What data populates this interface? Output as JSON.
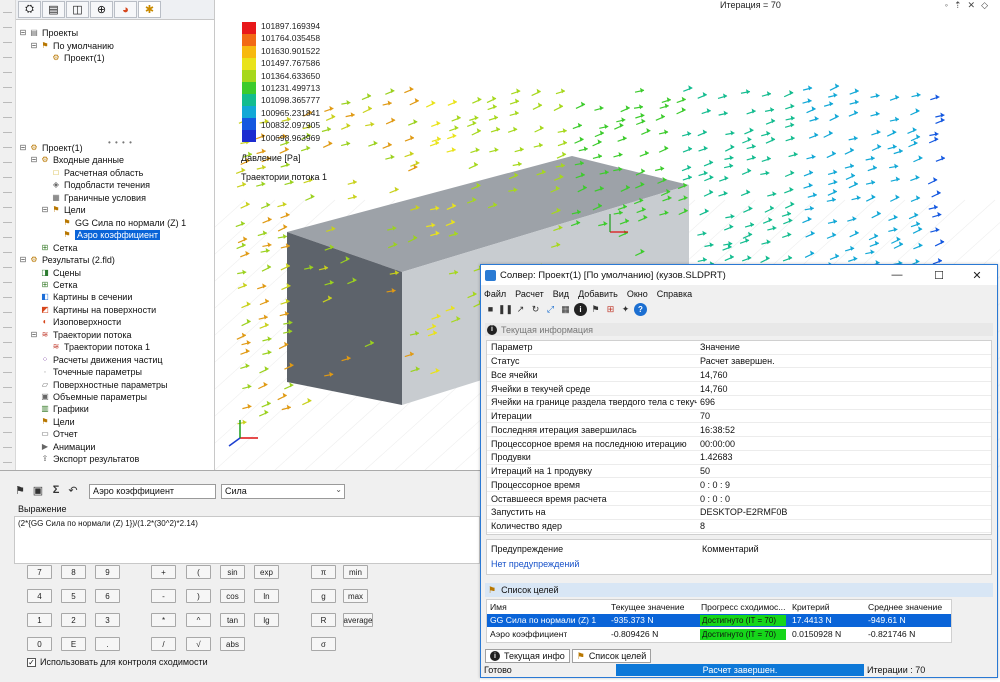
{
  "feature_tree": {
    "top": [
      {
        "label": "Проекты",
        "icon": "projects-icon",
        "level": 0
      },
      {
        "label": "По умолчанию",
        "icon": "config-icon",
        "level": 1
      },
      {
        "label": "Проект(1)",
        "icon": "project-icon",
        "level": 2
      }
    ],
    "bottom": [
      {
        "label": "Проект(1)",
        "icon": "project-icon",
        "level": 0
      },
      {
        "label": "Входные данные",
        "icon": "input-data-icon",
        "level": 1
      },
      {
        "label": "Расчетная область",
        "icon": "domain-icon",
        "level": 2
      },
      {
        "label": "Подобласти течения",
        "icon": "subdomain-icon",
        "level": 2
      },
      {
        "label": "Граничные условия",
        "icon": "boundary-icon",
        "level": 2
      },
      {
        "label": "Цели",
        "icon": "goals-icon",
        "level": 2
      },
      {
        "label": "GG Сила по нормали (Z) 1",
        "icon": "goal-icon",
        "level": 3
      },
      {
        "label": "Аэро коэффициент",
        "icon": "goal-icon",
        "level": 3,
        "selected": true
      },
      {
        "label": "Сетка",
        "icon": "mesh-icon",
        "level": 1
      },
      {
        "label": "Результаты (2.fld)",
        "icon": "results-icon",
        "level": 0
      },
      {
        "label": "Сцены",
        "icon": "scenes-icon",
        "level": 1
      },
      {
        "label": "Сетка",
        "icon": "mesh-icon",
        "level": 1
      },
      {
        "label": "Картины в сечении",
        "icon": "cut-plot-icon",
        "level": 1
      },
      {
        "label": "Картины на поверхности",
        "icon": "surface-plot-icon",
        "level": 1
      },
      {
        "label": "Изоповерхности",
        "icon": "isosurface-icon",
        "level": 1
      },
      {
        "label": "Траектории потока",
        "icon": "flow-traj-icon",
        "level": 1
      },
      {
        "label": "Траектории потока 1",
        "icon": "flow-traj-icon",
        "level": 2
      },
      {
        "label": "Расчеты движения частиц",
        "icon": "particle-icon",
        "level": 1
      },
      {
        "label": "Точечные параметры",
        "icon": "point-params-icon",
        "level": 1
      },
      {
        "label": "Поверхностные параметры",
        "icon": "surface-params-icon",
        "level": 1
      },
      {
        "label": "Объемные параметры",
        "icon": "volume-params-icon",
        "level": 1
      },
      {
        "label": "Графики",
        "icon": "graphs-icon",
        "level": 1
      },
      {
        "label": "Цели",
        "icon": "goals-icon",
        "level": 1
      },
      {
        "label": "Отчет",
        "icon": "report-icon",
        "level": 1
      },
      {
        "label": "Анимации",
        "icon": "animation-icon",
        "level": 1
      },
      {
        "label": "Экспорт результатов",
        "icon": "export-icon",
        "level": 1
      }
    ]
  },
  "viewport": {
    "iteration_label": "Итерация = 70",
    "legend_values": [
      "101897.169394",
      "101764.035458",
      "101630.901522",
      "101497.767586",
      "101364.633650",
      "101231.499713",
      "101098.365777",
      "100965.231841",
      "100832.097905",
      "100698.963969"
    ],
    "legend_title": "Давление [Pa]",
    "trajectory_title": "Траектории потока 1",
    "legend_colors": [
      "#e8181a",
      "#f26a14",
      "#f7b90f",
      "#e9e31a",
      "#a6d81c",
      "#3ccb2c",
      "#13bc8f",
      "#12a8d6",
      "#1458e0",
      "#1c2bd0"
    ]
  },
  "expression_editor": {
    "name_value": "Аэро коэффициент",
    "type_value": "Сила",
    "label": "Выражение",
    "expression": "(2*{GG Сила по нормали (Z) 1})/(1.2*(30^2)*2.14)",
    "keys": [
      [
        "7",
        "8",
        "9"
      ],
      [
        "4",
        "5",
        "6"
      ],
      [
        "1",
        "2",
        "3"
      ],
      [
        "0",
        "E",
        "."
      ]
    ],
    "ops": [
      [
        "+",
        "("
      ],
      [
        "-",
        ")"
      ],
      [
        "*",
        "^"
      ],
      [
        "/",
        "√"
      ]
    ],
    "funcs": [
      [
        "sin",
        "exp"
      ],
      [
        "cos",
        "ln"
      ],
      [
        "tan",
        "lg"
      ],
      [
        "abs",
        ""
      ]
    ],
    "consts": [
      [
        "π",
        "min"
      ],
      [
        "g",
        "max"
      ],
      [
        "R",
        "average"
      ],
      [
        "σ",
        ""
      ]
    ],
    "use_for_convergence_label": "Использовать для контроля сходимости",
    "use_for_convergence": true
  },
  "solver": {
    "title": "Солвер: Проект(1) [По умолчанию] (кузов.SLDPRT)",
    "menu": [
      "Файл",
      "Расчет",
      "Вид",
      "Добавить",
      "Окно",
      "Справка"
    ],
    "current_info_header": "Текущая информация",
    "params_header": {
      "name": "Параметр",
      "value": "Значение"
    },
    "params": [
      {
        "name": "Статус",
        "value": "Расчет завершен."
      },
      {
        "name": "Все ячейки",
        "value": "14,760"
      },
      {
        "name": "Ячейки в текучей среде",
        "value": "14,760"
      },
      {
        "name": "Ячейки на границе раздела твердого тела с текуч...",
        "value": "696"
      },
      {
        "name": "Итерации",
        "value": "70"
      },
      {
        "name": "Последняя итерация завершилась",
        "value": "16:38:52"
      },
      {
        "name": "Процессорное время на последнюю итерацию",
        "value": "00:00:00"
      },
      {
        "name": "Продувки",
        "value": "1.42683"
      },
      {
        "name": "Итераций на 1 продувку",
        "value": "50"
      },
      {
        "name": "Процессорное время",
        "value": "0 : 0 : 9"
      },
      {
        "name": "Оставшееся время расчета",
        "value": "0 : 0 : 0"
      },
      {
        "name": "Запустить на",
        "value": "DESKTOP-E2RMF0B"
      },
      {
        "name": "Количество ядер",
        "value": "8"
      }
    ],
    "warning_header": "Предупреждение",
    "comment_header": "Комментарий",
    "no_warnings": "Нет предупреждений",
    "goals_header": "Список целей",
    "goals_columns": [
      "Имя",
      "Текущее значение",
      "Прогресс сходимос...",
      "Критерий",
      "Среднее значение"
    ],
    "goals": [
      {
        "name": "GG Сила по нормали (Z) 1",
        "current": "-935.373 N",
        "progress": "Достигнуто (IT = 70)",
        "progress_fraction": 1.0,
        "criterion": "17.4413 N",
        "average": "-949.61 N",
        "selected": true
      },
      {
        "name": "Аэро коэффициент",
        "current": "-0.809426 N",
        "progress": "Достигнуто (IT = 70)",
        "progress_fraction": 1.0,
        "criterion": "0.0150928 N",
        "average": "-0.821746 N",
        "selected": false
      }
    ],
    "tabs": [
      "Текущая инфо",
      "Список целей"
    ],
    "status_left": "Готово",
    "status_center": "Расчет завершен.",
    "status_right": "Итерации : 70"
  }
}
